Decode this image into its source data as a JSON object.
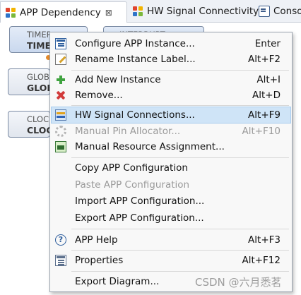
{
  "tabs": [
    {
      "label": "APP Dependency",
      "close": "⊠",
      "active": true
    },
    {
      "label": "HW Signal Connectivity",
      "active": false
    },
    {
      "label": "Conso",
      "active": false
    }
  ],
  "diagram": {
    "nodes": [
      {
        "type": "TIMER",
        "instance": "TIME"
      },
      {
        "type": "INTERRUPT",
        "instance": ""
      },
      {
        "type": "GLOB",
        "instance": "GLOB"
      },
      {
        "type": "CLOC",
        "instance": "CLOC"
      }
    ]
  },
  "context_menu": {
    "items": [
      {
        "label": "Configure APP Instance...",
        "shortcut": "Enter",
        "icon": "configure-icon",
        "enabled": true
      },
      {
        "label": "Rename Instance Label...",
        "shortcut": "Alt+F2",
        "icon": "rename-icon",
        "enabled": true
      },
      {
        "label": "Add New Instance",
        "shortcut": "Alt+I",
        "icon": "plus-icon",
        "enabled": true
      },
      {
        "label": "Remove...",
        "shortcut": "Alt+D",
        "icon": "remove-icon",
        "enabled": true
      },
      {
        "label": "HW Signal Connections...",
        "shortcut": "Alt+F9",
        "icon": "signal-connections-icon",
        "enabled": true,
        "highlighted": true
      },
      {
        "label": "Manual Pin Allocator...",
        "shortcut": "Alt+F10",
        "icon": "pin-allocator-icon",
        "enabled": false
      },
      {
        "label": "Manual Resource Assignment...",
        "shortcut": "",
        "icon": "resource-assignment-icon",
        "enabled": true
      },
      {
        "label": "Copy APP Configuration",
        "shortcut": "",
        "enabled": true
      },
      {
        "label": "Paste APP Configuration",
        "shortcut": "",
        "enabled": false
      },
      {
        "label": "Import APP Configuration...",
        "shortcut": "",
        "enabled": true
      },
      {
        "label": "Export APP Configuration...",
        "shortcut": "",
        "enabled": true
      },
      {
        "label": "APP Help",
        "shortcut": "Alt+F3",
        "icon": "help-icon",
        "enabled": true
      },
      {
        "label": "Properties",
        "shortcut": "Alt+F12",
        "icon": "properties-icon",
        "enabled": true
      },
      {
        "label": "Export Diagram...",
        "shortcut": "",
        "enabled": true
      }
    ]
  },
  "watermark": "CSDN @六月悉茗",
  "colors": {
    "menu_highlight": "#cfe4f7",
    "disabled_text": "#9a9a9a",
    "node_fill": "#c9d8ee"
  }
}
